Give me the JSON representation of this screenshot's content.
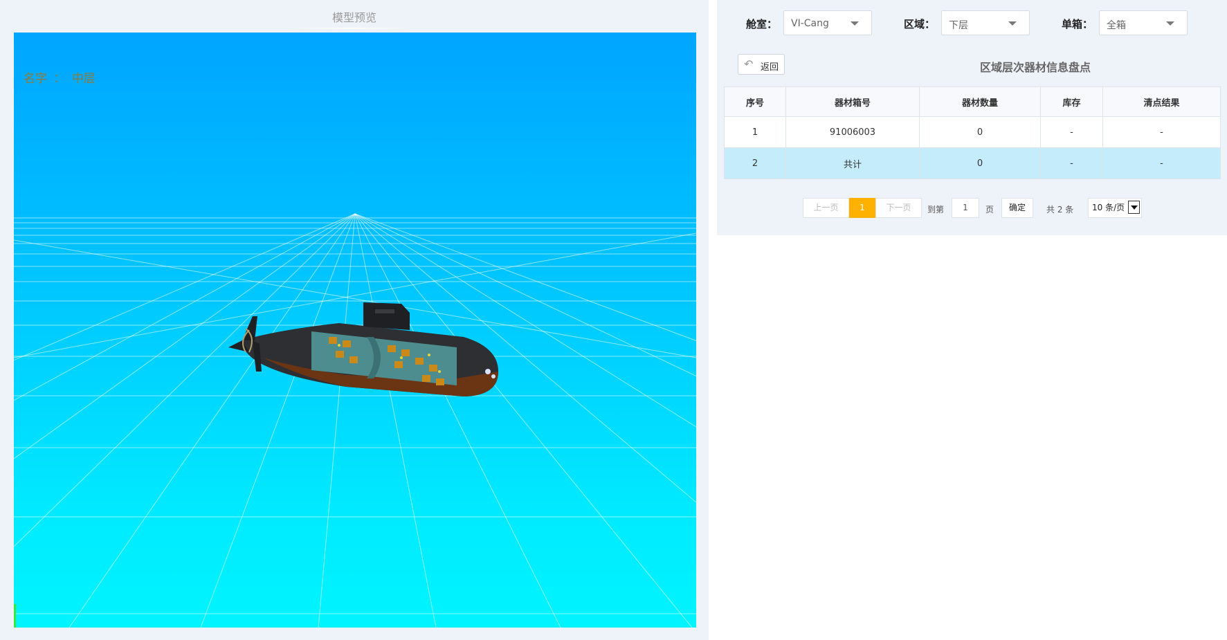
{
  "preview": {
    "title": "模型预览",
    "overlay_key": "名字",
    "overlay_sep": "：",
    "overlay_value": "中层"
  },
  "filters": {
    "cabin_label": "舱室：",
    "cabin_value": "VI-Cang",
    "area_label": "区域：",
    "area_value": "下层",
    "box_label": "单箱：",
    "box_value": "全箱"
  },
  "toolbar": {
    "back_label": "返回",
    "section_title": "区域层次器材信息盘点"
  },
  "table": {
    "headers": [
      "序号",
      "器材箱号",
      "器材数量",
      "库存",
      "清点结果"
    ],
    "rows": [
      [
        "1",
        "91006003",
        "0",
        "-",
        "-"
      ],
      [
        "2",
        "共计",
        "0",
        "-",
        "-"
      ]
    ]
  },
  "pagination": {
    "prev": "上一页",
    "current": "1",
    "next": "下一页",
    "goto_label": "到第",
    "goto_value": "1",
    "page_unit": "页",
    "confirm": "确定",
    "total": "共 2 条",
    "page_size": "10 条/页"
  },
  "colors": {
    "sky_top": "#00a5ff",
    "sky_bottom": "#00f4ff",
    "page_active": "#ffb100",
    "row_highlight": "#c5ecfb"
  }
}
